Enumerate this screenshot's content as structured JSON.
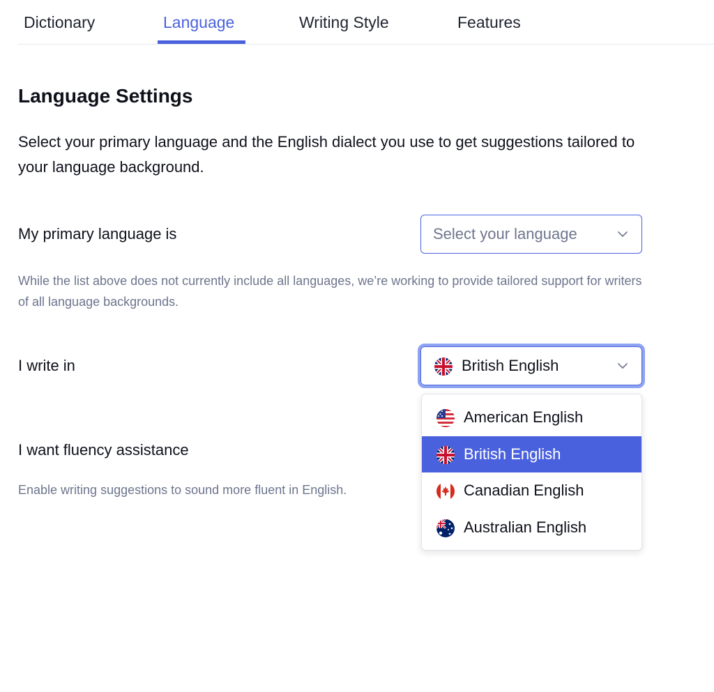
{
  "tabs": [
    {
      "label": "Dictionary",
      "active": false
    },
    {
      "label": "Language",
      "active": true
    },
    {
      "label": "Writing Style",
      "active": false
    },
    {
      "label": "Features",
      "active": false
    }
  ],
  "settings": {
    "title": "Language Settings",
    "intro": "Select your primary language and the English dialect you use to get suggestions tailored to your language background.",
    "primary_language": {
      "label": "My primary language is",
      "placeholder": "Select your language",
      "hint": "While the list above does not currently include all languages, we’re working to provide tailored support for writers of all language backgrounds."
    },
    "dialect": {
      "label": "I write in",
      "selected": "British English",
      "selected_icon": "uk-flag-icon",
      "options": [
        {
          "label": "American English",
          "icon": "us-flag-icon",
          "selected": false
        },
        {
          "label": "British English",
          "icon": "uk-flag-icon",
          "selected": true
        },
        {
          "label": "Canadian English",
          "icon": "canada-flag-icon",
          "selected": false
        },
        {
          "label": "Australian English",
          "icon": "australia-flag-icon",
          "selected": false
        }
      ]
    },
    "fluency": {
      "label": "I want fluency assistance",
      "hint": "Enable writing suggestions to sound more fluent in English."
    }
  },
  "colors": {
    "accent": "#4a61dd",
    "focus_ring": "#8ea4f2",
    "text": "#0e101a",
    "muted_text": "#6d758d"
  }
}
